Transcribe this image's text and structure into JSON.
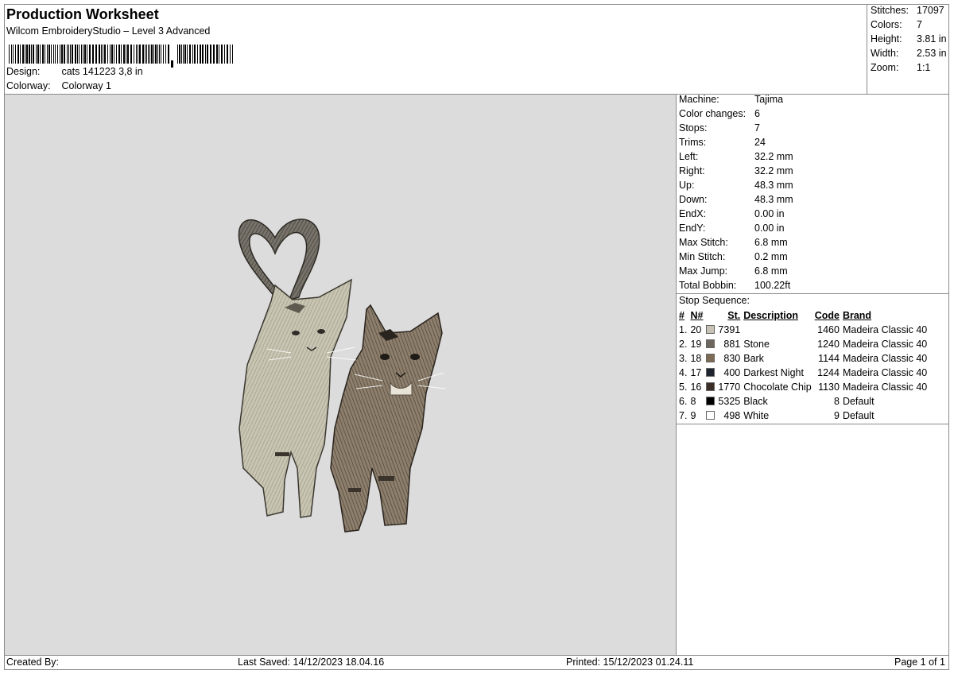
{
  "header": {
    "title": "Production Worksheet",
    "subtitle": "Wilcom EmbroideryStudio – Level 3 Advanced",
    "design_label": "Design:",
    "design_value": "cats 141223 3,8 in",
    "colorway_label": "Colorway:",
    "colorway_value": "Colorway 1"
  },
  "stats": [
    {
      "label": "Stitches:",
      "value": "17097"
    },
    {
      "label": "Colors:",
      "value": "7"
    },
    {
      "label": "Height:",
      "value": "3.81 in"
    },
    {
      "label": "Width:",
      "value": "2.53 in"
    },
    {
      "label": "Zoom:",
      "value": "1:1"
    }
  ],
  "properties": [
    {
      "label": "Machine:",
      "value": "Tajima"
    },
    {
      "label": "Color changes:",
      "value": "6"
    },
    {
      "label": "Stops:",
      "value": "7"
    },
    {
      "label": "Trims:",
      "value": "24"
    },
    {
      "label": "Left:",
      "value": "32.2 mm"
    },
    {
      "label": "Right:",
      "value": "32.2 mm"
    },
    {
      "label": "Up:",
      "value": "48.3 mm"
    },
    {
      "label": "Down:",
      "value": "48.3 mm"
    },
    {
      "label": "EndX:",
      "value": "0.00 in"
    },
    {
      "label": "EndY:",
      "value": "0.00 in"
    },
    {
      "label": "Max Stitch:",
      "value": "6.8 mm"
    },
    {
      "label": "Min Stitch:",
      "value": "0.2 mm"
    },
    {
      "label": "Max Jump:",
      "value": "6.8 mm"
    },
    {
      "label": "Total Bobbin:",
      "value": "100.22ft"
    }
  ],
  "stop_sequence": {
    "title": "Stop Sequence:",
    "headers": {
      "num": "#",
      "n": "N#",
      "st": "St.",
      "description": "Description",
      "code": "Code",
      "brand": "Brand"
    },
    "rows": [
      {
        "num": "1.",
        "n": "20",
        "color": "#c8c2b6",
        "st": "7391",
        "description": "",
        "code": "1460",
        "brand": "Madeira Classic 40"
      },
      {
        "num": "2.",
        "n": "19",
        "color": "#6c665e",
        "st": "881",
        "description": "Stone",
        "code": "1240",
        "brand": "Madeira Classic 40"
      },
      {
        "num": "3.",
        "n": "18",
        "color": "#7d6a55",
        "st": "830",
        "description": "Bark",
        "code": "1144",
        "brand": "Madeira Classic 40"
      },
      {
        "num": "4.",
        "n": "17",
        "color": "#1e2430",
        "st": "400",
        "description": "Darkest Night",
        "code": "1244",
        "brand": "Madeira Classic 40"
      },
      {
        "num": "5.",
        "n": "16",
        "color": "#3a2e26",
        "st": "1770",
        "description": "Chocolate Chip",
        "code": "1130",
        "brand": "Madeira Classic 40"
      },
      {
        "num": "6.",
        "n": "8",
        "color": "#000000",
        "st": "5325",
        "description": "Black",
        "code": "8",
        "brand": "Default"
      },
      {
        "num": "7.",
        "n": "9",
        "color": "#ffffff",
        "st": "498",
        "description": "White",
        "code": "9",
        "brand": "Default"
      }
    ]
  },
  "footer": {
    "created_by": "Created By:",
    "last_saved": "Last Saved: 14/12/2023 18.04.16",
    "printed": "Printed: 15/12/2023 01.24.11",
    "page": "Page 1 of 1"
  }
}
